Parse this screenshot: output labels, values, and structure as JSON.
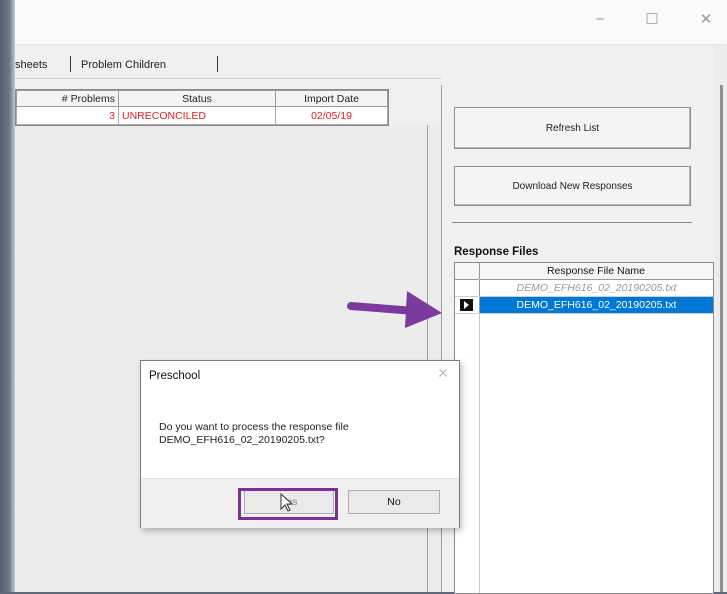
{
  "window": {
    "controls": {
      "minimize": "−",
      "maximize": "☐",
      "close": "✕"
    },
    "tabs": [
      {
        "label": "sheets"
      },
      {
        "label": "Problem Children"
      }
    ]
  },
  "grid": {
    "columns": [
      "# Problems",
      "Status",
      "Import Date"
    ],
    "rows": [
      {
        "problems": "3",
        "status": "UNRECONCILED",
        "import_date": "02/05/19"
      }
    ]
  },
  "right_panel": {
    "refresh_label": "Refresh List",
    "download_label": "Download New Responses",
    "response_files_title": "Response Files",
    "column_header": "Response File Name",
    "files": [
      {
        "name": "DEMO_EFH616_02_20190205.txt"
      },
      {
        "name": "DEMO_EFH616_02_20190205.txt"
      }
    ]
  },
  "dialog": {
    "title": "Preschool",
    "close": "✕",
    "message_line1": "Do you want to process the response file",
    "message_line2": "DEMO_EFH616_02_20190205.txt?",
    "yes_label": "Yes",
    "no_label": "No"
  },
  "colors": {
    "arrow": "#7b3a9e",
    "highlight": "#7a2f99",
    "selection": "#0078d7",
    "status_text": "#e02020"
  }
}
